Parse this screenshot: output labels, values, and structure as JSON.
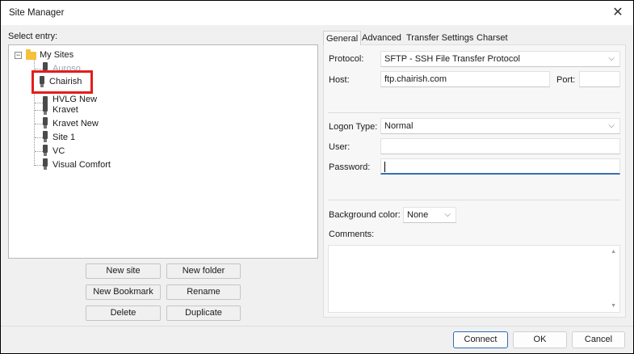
{
  "window": {
    "title": "Site Manager",
    "close_glyph": "✕"
  },
  "left": {
    "select_entry_label": "Select entry:",
    "root": {
      "label": "My Sites",
      "expander": "−",
      "icon": "folder-icon"
    },
    "sites": [
      {
        "label": "Auroso",
        "icon": "server-icon"
      },
      {
        "label": "Chairish",
        "icon": "server-icon"
      },
      {
        "label": "HVLG New",
        "icon": "server-icon"
      },
      {
        "label": "Kravet",
        "icon": "server-icon"
      },
      {
        "label": "Kravet New",
        "icon": "server-icon"
      },
      {
        "label": "Site 1",
        "icon": "server-icon"
      },
      {
        "label": "VC",
        "icon": "server-icon"
      },
      {
        "label": "Visual Comfort",
        "icon": "server-icon"
      }
    ],
    "highlight_color": "#e31d1d",
    "buttons": {
      "new_site": "New site",
      "new_folder": "New folder",
      "new_bookmark": "New Bookmark",
      "rename": "Rename",
      "delete": "Delete",
      "duplicate": "Duplicate"
    }
  },
  "tabs": [
    "General",
    "Advanced",
    "Transfer Settings",
    "Charset"
  ],
  "general": {
    "protocol_label": "Protocol:",
    "protocol_value": "SFTP - SSH File Transfer Protocol",
    "host_label": "Host:",
    "host_value": "ftp.chairish.com",
    "port_label": "Port:",
    "port_value": "",
    "logon_type_label": "Logon Type:",
    "logon_type_value": "Normal",
    "user_label": "User:",
    "user_value": "",
    "password_label": "Password:",
    "password_value": "",
    "background_color_label": "Background color:",
    "background_color_value": "None",
    "comments_label": "Comments:",
    "comments_value": "",
    "chevron_glyph": "⌵",
    "scroll_up_glyph": "▲",
    "scroll_down_glyph": "▼"
  },
  "footer": {
    "connect": "Connect",
    "ok": "OK",
    "cancel": "Cancel"
  },
  "colors": {
    "accent": "#2f6db5",
    "folder": "#f4c13a"
  }
}
